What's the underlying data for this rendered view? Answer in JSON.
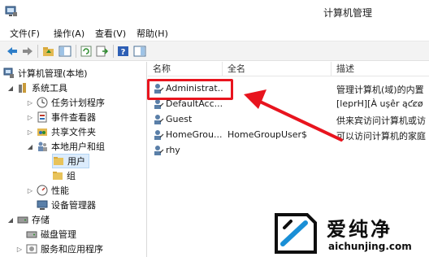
{
  "window": {
    "title": "计算机管理"
  },
  "menu": [
    {
      "label": "文件(F)"
    },
    {
      "label": "操作(A)"
    },
    {
      "label": "查看(V)"
    },
    {
      "label": "帮助(H)"
    }
  ],
  "tree": [
    {
      "label": "计算机管理(本地)",
      "icon": "computer-management-icon",
      "expander": ""
    },
    {
      "label": "系统工具",
      "icon": "tools-icon",
      "expander": "◢"
    },
    {
      "label": "任务计划程序",
      "icon": "clock-icon",
      "expander": "▷"
    },
    {
      "label": "事件查看器",
      "icon": "event-viewer-icon",
      "expander": "▷"
    },
    {
      "label": "共享文件夹",
      "icon": "shared-folder-icon",
      "expander": "▷"
    },
    {
      "label": "本地用户和组",
      "icon": "users-icon",
      "expander": "◢"
    },
    {
      "label": "用户",
      "icon": "folder-icon",
      "expander": ""
    },
    {
      "label": "组",
      "icon": "folder-icon",
      "expander": ""
    },
    {
      "label": "性能",
      "icon": "performance-icon",
      "expander": "▷"
    },
    {
      "label": "设备管理器",
      "icon": "device-manager-icon",
      "expander": ""
    },
    {
      "label": "存储",
      "icon": "storage-icon",
      "expander": "◢"
    },
    {
      "label": "磁盘管理",
      "icon": "disk-icon",
      "expander": ""
    },
    {
      "label": "服务和应用程序",
      "icon": "services-icon",
      "expander": "▷"
    }
  ],
  "columns": {
    "name": "名称",
    "fullname": "全名",
    "description": "描述"
  },
  "users": [
    {
      "name": "Administrat...",
      "fullname": "",
      "description": "管理计算机(域)的内置"
    },
    {
      "name": "DefaultAcc...",
      "fullname": "",
      "description": "[leprH][À uşêr ąƈȼø"
    },
    {
      "name": "Guest",
      "fullname": "",
      "description": "供来宾访问计算机或访"
    },
    {
      "name": "HomeGrou...",
      "fullname": "HomeGroupUser$",
      "description": "可以访问计算机的家庭"
    },
    {
      "name": "rhy",
      "fullname": "",
      "description": ""
    }
  ],
  "watermark": {
    "text": "爱纯净",
    "url": "aichunjing.com"
  },
  "colors": {
    "highlight": "#e8141e",
    "selection": "#dcecfc"
  }
}
